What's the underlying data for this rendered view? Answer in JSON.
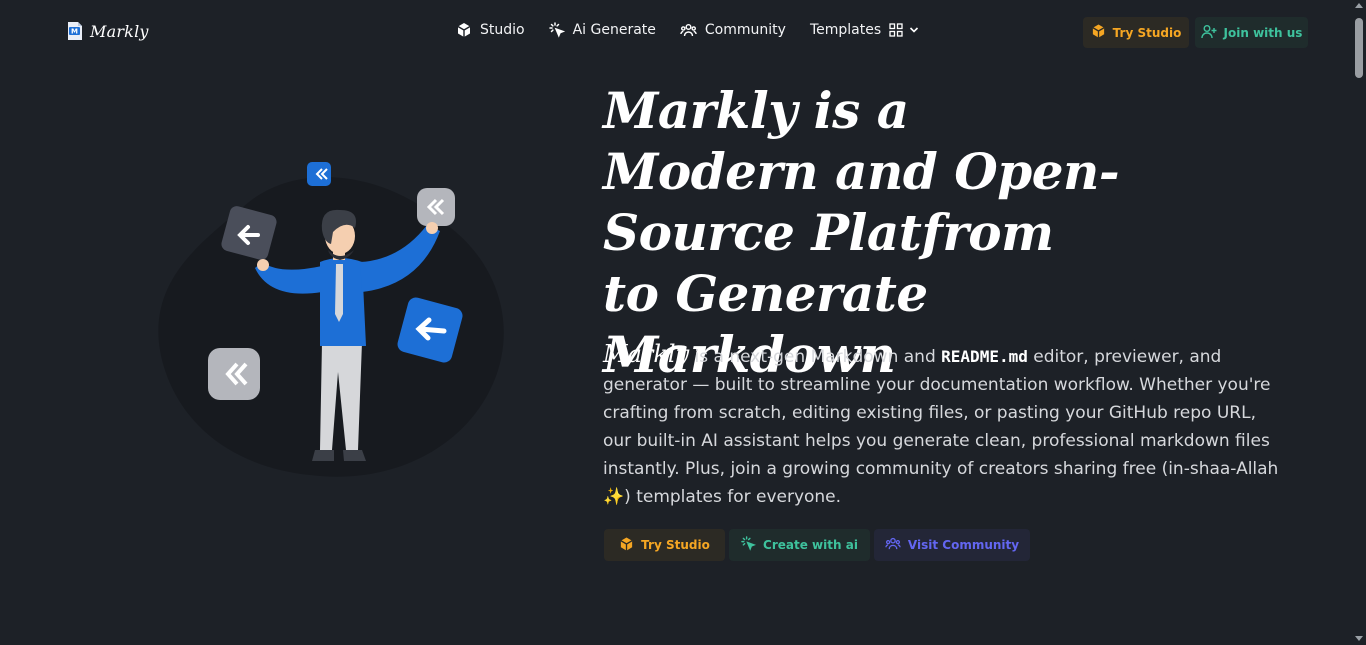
{
  "nav": {
    "brand": "Markly",
    "links": [
      {
        "label": "Studio",
        "icon": "cube-icon"
      },
      {
        "label": "Ai Generate",
        "icon": "sparkle-cursor-icon"
      },
      {
        "label": "Community",
        "icon": "users-icon"
      },
      {
        "label": "Templates",
        "icon": "grid-icon"
      }
    ],
    "actions": {
      "try_studio": "Try Studio",
      "join": "Join with us"
    }
  },
  "hero": {
    "title": "Markly is a Modern and Open-Source Platfrom to Generate Markdown",
    "desc_brand": "Markly",
    "desc_part1": " is a next-gen Markdown and ",
    "desc_code": "README.md",
    "desc_part2": " editor, previewer, and generator — built to streamline your documentation workflow. Whether you're crafting from scratch, editing existing files, or pasting your GitHub repo URL, our built-in AI assistant helps you generate clean, professional markdown files instantly. Plus, join a growing community of creators sharing free (in-shaa-Allah ✨) templates for everyone.",
    "cta": {
      "studio": "Try Studio",
      "ai": "Create with ai",
      "community": "Visit Community"
    }
  },
  "colors": {
    "background": "#1d2127",
    "studio_accent": "#f5a623",
    "ai_accent": "#3ec29d",
    "community_accent": "#6366f1",
    "illustration_blue": "#1d6fd6"
  }
}
